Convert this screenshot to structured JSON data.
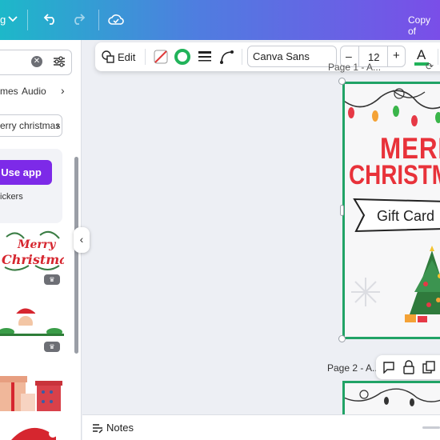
{
  "topbar": {
    "menu_label": "g",
    "title": "Copy of"
  },
  "left_panel": {
    "search": {
      "placeholder": "",
      "value": ""
    },
    "tabs": [
      "mes",
      "Audio"
    ],
    "suggestion": "erry christmas",
    "use_app_label": "Use app",
    "stickers_label": "ickers",
    "sticker_items": [
      "Merry Christmas",
      "Santa",
      "Gifts",
      "Santa hat"
    ]
  },
  "toolbar": {
    "edit_label": "Edit",
    "font_name": "Canva Sans",
    "font_size": "12",
    "minus": "–",
    "plus": "+",
    "text_color_letter": "A"
  },
  "canvas": {
    "page1_label": "Page 1 - A...",
    "page2_label": "Page 2 - A...",
    "design_text_1": "MERRY",
    "design_text_2": "CHRISTMAS",
    "gift_text": "Gift Card",
    "text_color": "#e8323a",
    "selection_color": "#21a366"
  },
  "bottom": {
    "notes_label": "Notes"
  },
  "colors": {
    "accent": "#7d2ae8"
  }
}
